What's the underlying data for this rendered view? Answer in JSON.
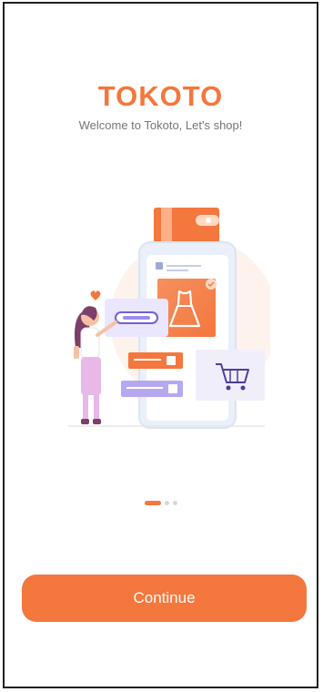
{
  "app": {
    "brand_name": "TOKOTO",
    "tagline": "Welcome to Tokoto, Let's shop!"
  },
  "pagination": {
    "total": 3,
    "current": 1
  },
  "cta": {
    "label": "Continue"
  },
  "illustration": {
    "icons": [
      "person-icon",
      "dress-icon",
      "shopping-cart-icon",
      "check-icon",
      "heart-icon"
    ]
  },
  "colors": {
    "accent": "#f4773d",
    "accent_light": "#fbe3d4",
    "lavender": "#b6a8f0",
    "text_muted": "#757575",
    "dot_inactive": "#d8d8d8"
  }
}
